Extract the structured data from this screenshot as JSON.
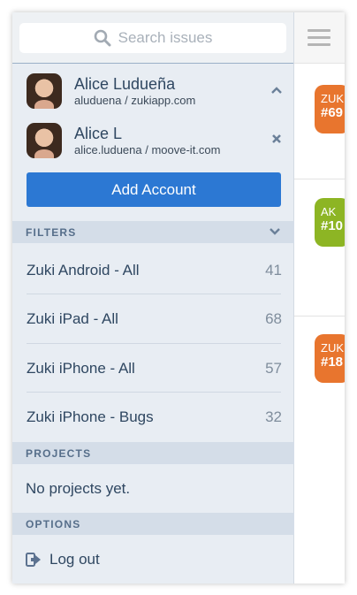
{
  "search": {
    "placeholder": "Search issues"
  },
  "accounts": [
    {
      "name": "Alice Ludueña",
      "detail": "aluduena / zukiapp.com",
      "action_icon": "chevron-up-icon"
    },
    {
      "name": "Alice L",
      "detail": "alice.luduena / moove-it.com",
      "action_icon": "close-icon"
    }
  ],
  "add_account_label": "Add Account",
  "filters": {
    "header": "FILTERS",
    "items": [
      {
        "label": "Zuki Android - All",
        "count": "41"
      },
      {
        "label": "Zuki iPad - All",
        "count": "68"
      },
      {
        "label": "Zuki iPhone - All",
        "count": "57"
      },
      {
        "label": "Zuki iPhone - Bugs",
        "count": "32"
      }
    ]
  },
  "projects": {
    "header": "PROJECTS",
    "empty_text": "No projects yet."
  },
  "options": {
    "header": "OPTIONS",
    "logout_label": "Log out"
  },
  "issues": [
    {
      "project": "ZUK",
      "number": "#69",
      "color": "#e8752e"
    },
    {
      "project": "AK",
      "number": "#10",
      "color": "#8db524"
    },
    {
      "project": "ZUK",
      "number": "#18",
      "color": "#e8752e"
    }
  ],
  "colors": {
    "accent": "#2c78d3",
    "sidebar_bg": "#e8edf3",
    "section_header_bg": "#d4dde8"
  }
}
